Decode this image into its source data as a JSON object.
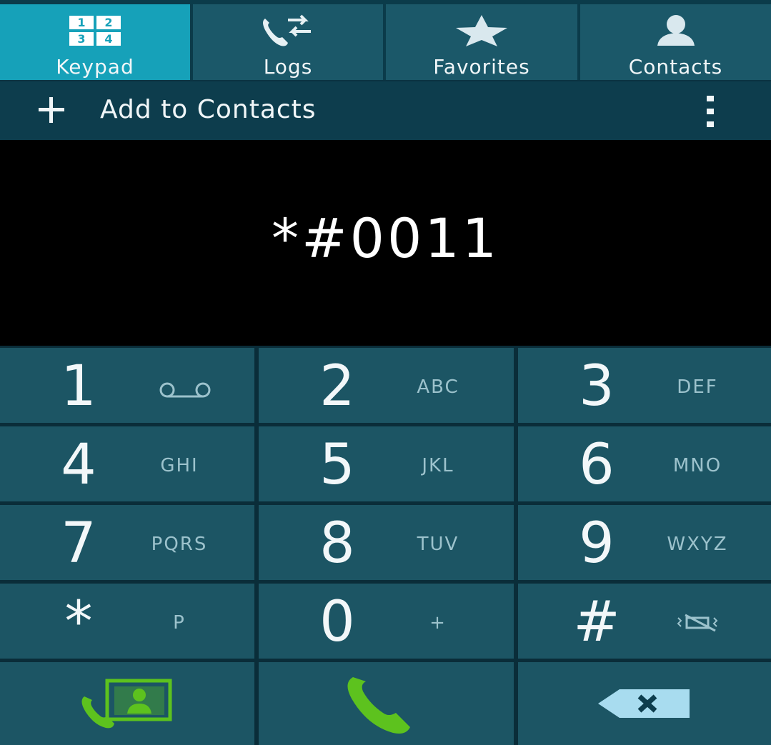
{
  "tabs": [
    {
      "label": "Keypad",
      "icon": "keypad-icon",
      "active": true
    },
    {
      "label": "Logs",
      "icon": "call-logs-icon",
      "active": false
    },
    {
      "label": "Favorites",
      "icon": "star-icon",
      "active": false
    },
    {
      "label": "Contacts",
      "icon": "person-icon",
      "active": false
    }
  ],
  "keypad_tab_icon_digits": [
    "1",
    "2",
    "3",
    "4"
  ],
  "add_bar": {
    "label": "Add to Contacts",
    "icon": "plus-icon",
    "menu_icon": "more-vert-icon"
  },
  "display": {
    "number": "*#0011"
  },
  "keys": [
    {
      "digit": "1",
      "letters": "",
      "sub_icon": "voicemail-icon"
    },
    {
      "digit": "2",
      "letters": "ABC"
    },
    {
      "digit": "3",
      "letters": "DEF"
    },
    {
      "digit": "4",
      "letters": "GHI"
    },
    {
      "digit": "5",
      "letters": "JKL"
    },
    {
      "digit": "6",
      "letters": "MNO"
    },
    {
      "digit": "7",
      "letters": "PQRS"
    },
    {
      "digit": "8",
      "letters": "TUV"
    },
    {
      "digit": "9",
      "letters": "WXYZ"
    },
    {
      "digit": "*",
      "letters": "P"
    },
    {
      "digit": "0",
      "letters": "+"
    },
    {
      "digit": "#",
      "letters": "",
      "sub_icon": "mute-icon"
    }
  ],
  "actions": [
    {
      "name": "video-call-button",
      "icon": "video-call-icon"
    },
    {
      "name": "call-button",
      "icon": "phone-icon"
    },
    {
      "name": "backspace-button",
      "icon": "backspace-icon"
    }
  ],
  "colors": {
    "active_tab": "#16a1b9",
    "tab_bg": "#1b5869",
    "key_bg": "#1c5564",
    "call_green": "#5dc21e",
    "backspace_blue": "#a8dcef"
  }
}
